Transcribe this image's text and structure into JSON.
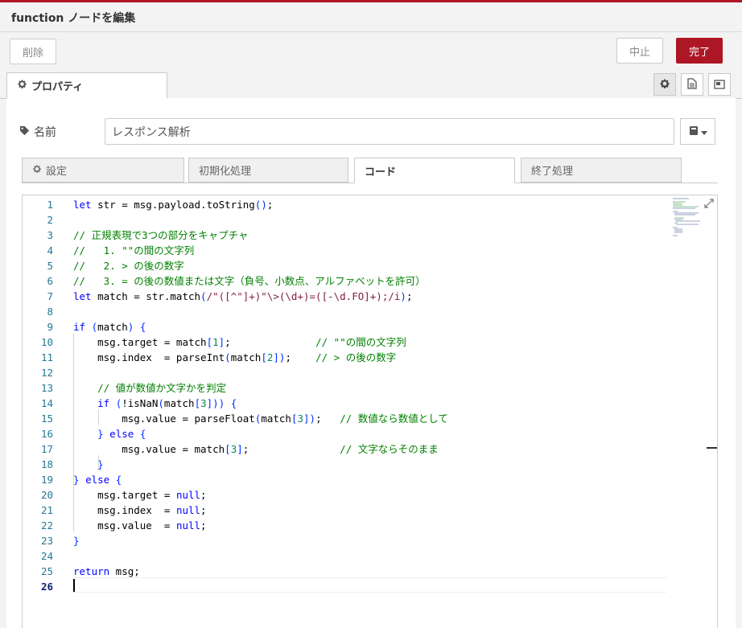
{
  "dialog": {
    "title": "function ノードを編集"
  },
  "toolbar": {
    "delete_label": "削除",
    "cancel_label": "中止",
    "done_label": "完了"
  },
  "tabs": {
    "properties_label": "プロパティ"
  },
  "name": {
    "label": "名前",
    "value": "レスポンス解析"
  },
  "subtabs": [
    {
      "label": "設定"
    },
    {
      "label": "初期化処理"
    },
    {
      "label": "コード"
    },
    {
      "label": "終了処理"
    }
  ],
  "colors": {
    "accent": "#ad1625",
    "keyword": "#0000ff",
    "comment": "#008000",
    "number": "#098658",
    "regex": "#811f3f"
  },
  "editor": {
    "current_line": 26,
    "lines": [
      "let str = msg.payload.toString();",
      "",
      "// 正規表現で3つの部分をキャプチャ",
      "//   1. \"\"の間の文字列",
      "//   2. > の後の数字",
      "//   3. = の後の数値または文字（負号、小数点、アルファベットを許可）",
      "let match = str.match(/\"([^\"]+)\"\\>(\\d+)=([-\\d.FO]+);/i);",
      "",
      "if (match) {",
      "    msg.target = match[1];              // \"\"の間の文字列",
      "    msg.index  = parseInt(match[2]);    // > の後の数字",
      "",
      "    // 値が数値か文字かを判定",
      "    if (!isNaN(match[3])) {",
      "        msg.value = parseFloat(match[3]);   // 数値なら数値として",
      "    } else {",
      "        msg.value = match[3];               // 文字ならそのまま",
      "    }",
      "} else {",
      "    msg.target = null;",
      "    msg.index  = null;",
      "    msg.value  = null;",
      "}",
      "",
      "return msg;",
      ""
    ]
  }
}
